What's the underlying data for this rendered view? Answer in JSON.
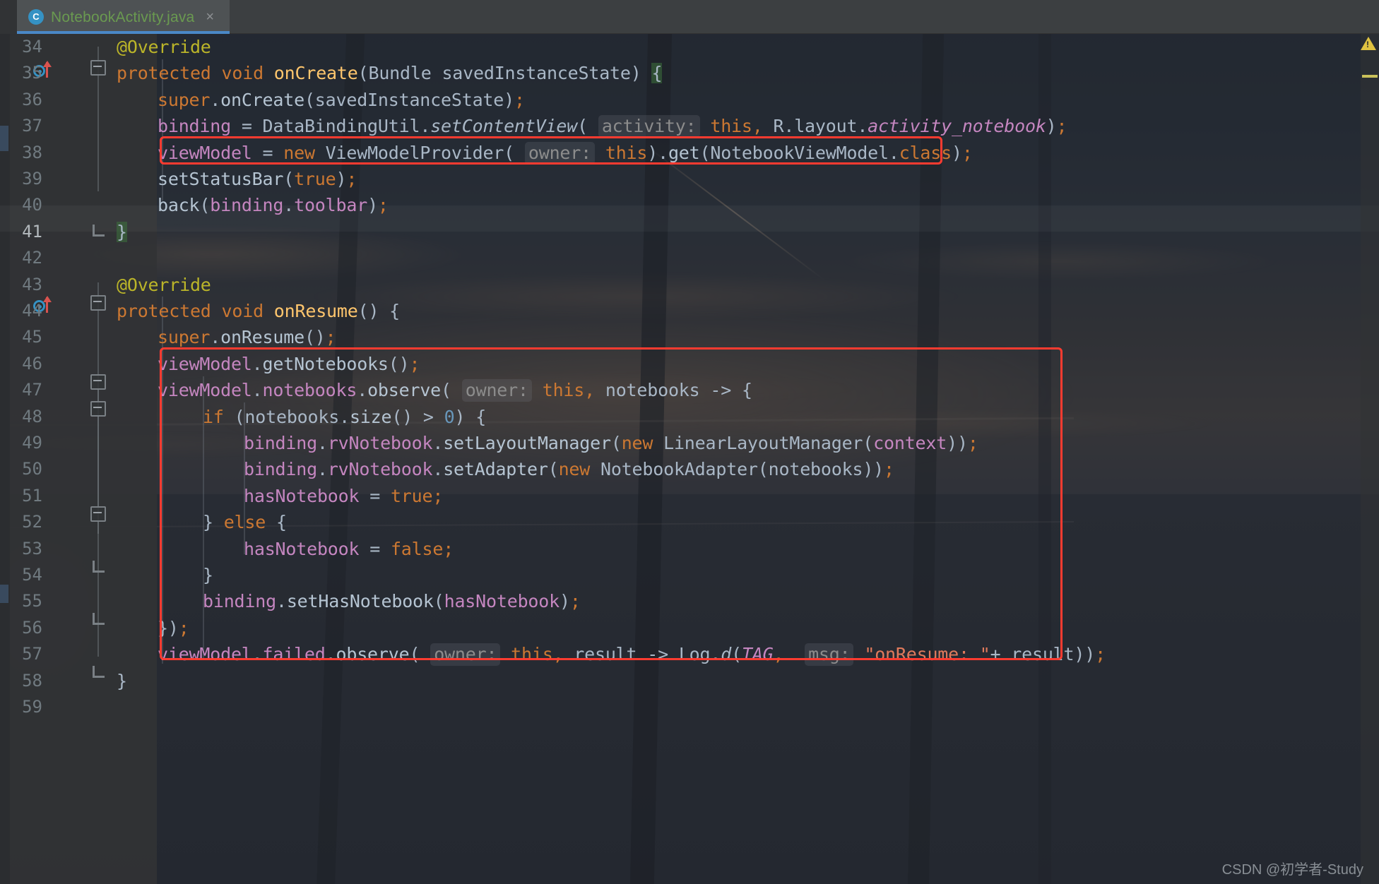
{
  "window": {
    "application": "IntelliJ IDEA / Android Studio",
    "theme_background": "#2b2b2b"
  },
  "tab": {
    "icon": "java-class-icon",
    "icon_glyph": "C",
    "filename": "NotebookActivity.java",
    "close_glyph": "×",
    "active_underline_color": "#4a88c7",
    "title_color": "#6a9a50"
  },
  "gutter": {
    "line_numbers": [
      "34",
      "35",
      "36",
      "37",
      "38",
      "39",
      "40",
      "41",
      "42",
      "43",
      "44",
      "45",
      "46",
      "47",
      "48",
      "49",
      "50",
      "51",
      "52",
      "53",
      "54",
      "55",
      "56",
      "57",
      "58",
      "59"
    ],
    "current_line": "41",
    "override_marker_lines": [
      "35",
      "44"
    ],
    "fold_marker_lines": [
      "35",
      "41",
      "44",
      "47",
      "48",
      "52",
      "54",
      "56",
      "58"
    ]
  },
  "editor": {
    "language": "Java",
    "lines": [
      {
        "n": "34",
        "indent": 1,
        "text": "@Override"
      },
      {
        "n": "35",
        "indent": 1,
        "text": "protected void onCreate(Bundle savedInstanceState) {"
      },
      {
        "n": "36",
        "indent": 2,
        "text": "super.onCreate(savedInstanceState);"
      },
      {
        "n": "37",
        "indent": 2,
        "text": "binding = DataBindingUtil.setContentView( activity: this, R.layout.activity_notebook);"
      },
      {
        "n": "38",
        "indent": 2,
        "text": "viewModel = new ViewModelProvider( owner: this).get(NotebookViewModel.class);"
      },
      {
        "n": "39",
        "indent": 2,
        "text": "setStatusBar(true);"
      },
      {
        "n": "40",
        "indent": 2,
        "text": "back(binding.toolbar);"
      },
      {
        "n": "41",
        "indent": 1,
        "text": "}"
      },
      {
        "n": "42",
        "indent": 0,
        "text": ""
      },
      {
        "n": "43",
        "indent": 1,
        "text": "@Override"
      },
      {
        "n": "44",
        "indent": 1,
        "text": "protected void onResume() {"
      },
      {
        "n": "45",
        "indent": 2,
        "text": "super.onResume();"
      },
      {
        "n": "46",
        "indent": 2,
        "text": "viewModel.getNotebooks();"
      },
      {
        "n": "47",
        "indent": 2,
        "text": "viewModel.notebooks.observe( owner: this, notebooks -> {"
      },
      {
        "n": "48",
        "indent": 3,
        "text": "if (notebooks.size() > 0) {"
      },
      {
        "n": "49",
        "indent": 4,
        "text": "binding.rvNotebook.setLayoutManager(new LinearLayoutManager(context));"
      },
      {
        "n": "50",
        "indent": 4,
        "text": "binding.rvNotebook.setAdapter(new NotebookAdapter(notebooks));"
      },
      {
        "n": "51",
        "indent": 4,
        "text": "hasNotebook = true;"
      },
      {
        "n": "52",
        "indent": 3,
        "text": "} else {"
      },
      {
        "n": "53",
        "indent": 4,
        "text": "hasNotebook = false;"
      },
      {
        "n": "54",
        "indent": 3,
        "text": "}"
      },
      {
        "n": "55",
        "indent": 3,
        "text": "binding.setHasNotebook(hasNotebook);"
      },
      {
        "n": "56",
        "indent": 2,
        "text": "});"
      },
      {
        "n": "57",
        "indent": 2,
        "text": "viewModel.failed.observe( owner: this, result -> Log.d(TAG,  msg: \"onResume: \"+ result));"
      },
      {
        "n": "58",
        "indent": 1,
        "text": "}"
      },
      {
        "n": "59",
        "indent": 0,
        "text": ""
      }
    ],
    "inlay_hints": [
      "activity:",
      "owner:",
      "msg:"
    ],
    "colors": {
      "keyword": "#cc7832",
      "field": "#c586c0",
      "annotation": "#bbb529",
      "string": "#e07a5c",
      "number": "#6897bb",
      "default_text": "#a9b7c6",
      "line_number": "#707a80"
    }
  },
  "annotations": {
    "boxes": [
      {
        "name": "highlight-box-viewmodel-init",
        "lines": "38",
        "color": "#ff3b30"
      },
      {
        "name": "highlight-box-onresume-body",
        "lines": "46-57",
        "color": "#ff3b30"
      }
    ]
  },
  "stripe": {
    "warning_icon": "warning-triangle-icon",
    "warning_color": "#e0c341"
  },
  "watermark": {
    "text": "CSDN @初学者-Study"
  }
}
